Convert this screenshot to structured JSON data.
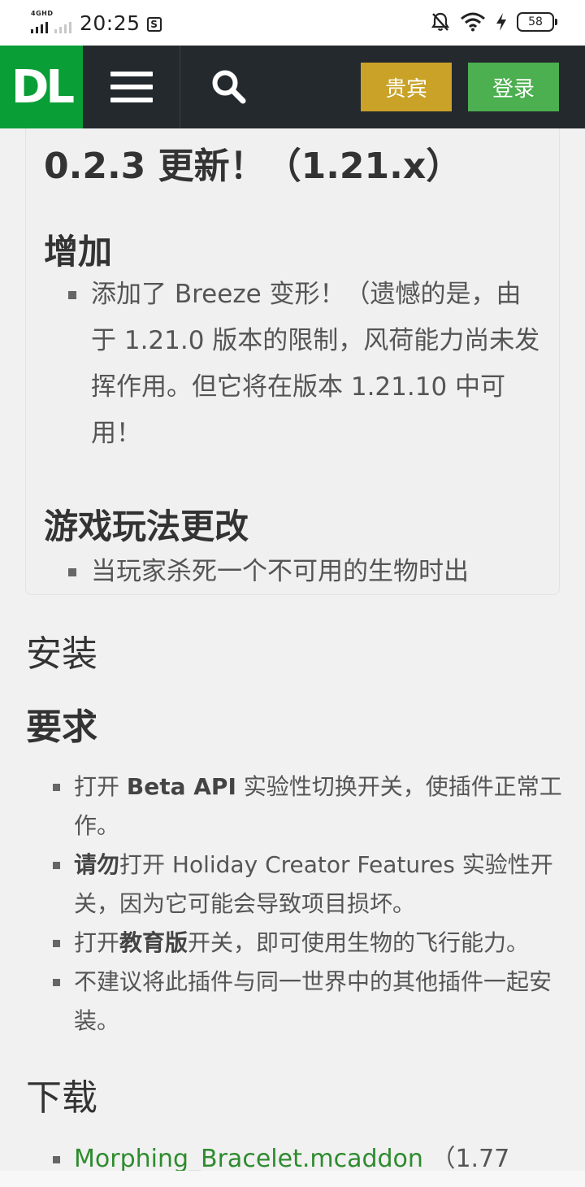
{
  "status_bar": {
    "network": "4GHD",
    "time": "20:25",
    "app_badge": "S",
    "battery": "58"
  },
  "nav": {
    "logo": "DL",
    "guest_label": "贵宾",
    "login_label": "登录"
  },
  "changelog": {
    "title": "0.2.3 更新！（1.21.x）",
    "sections": [
      {
        "heading": "增加",
        "items": [
          "添加了 Breeze 变形！（遗憾的是，由于 1.21.0 版本的限制，风荷能力尚未发挥作用。但它将在版本 1.21.10 中可用！"
        ]
      },
      {
        "heading": "游戏玩法更改",
        "items": [
          "当玩家杀死一个不可用的生物时出"
        ]
      }
    ]
  },
  "install": {
    "heading": "安装",
    "requirements_heading": "要求",
    "requirements": [
      {
        "pre": "打开 ",
        "bold": "Beta API",
        "post": " 实验性切换开关，使插件正常工作。"
      },
      {
        "pre": "",
        "bold": "请勿",
        "post": "打开 Holiday Creator Features 实验性开关，因为它可能会导致项目损坏。"
      },
      {
        "pre": "打开",
        "bold": "教育版",
        "post": "开关，即可使用生物的飞行能力。"
      },
      {
        "pre": "不建议将此插件与同一世界中的其他插件一起安装。",
        "bold": "",
        "post": ""
      }
    ]
  },
  "download": {
    "heading": "下载",
    "file_name": "Morphing_Bracelet.mcaddon",
    "file_size": "（1.77"
  },
  "colors": {
    "nav_bg": "#24292e",
    "logo_bg": "#0a9e37",
    "guest_button": "#c9a227",
    "login_button": "#4caf50",
    "link": "#2e8b2e"
  },
  "icons": [
    "menu-icon",
    "search-icon",
    "mute-icon",
    "wifi-icon",
    "charging-icon",
    "battery-icon",
    "signal-icon"
  ]
}
